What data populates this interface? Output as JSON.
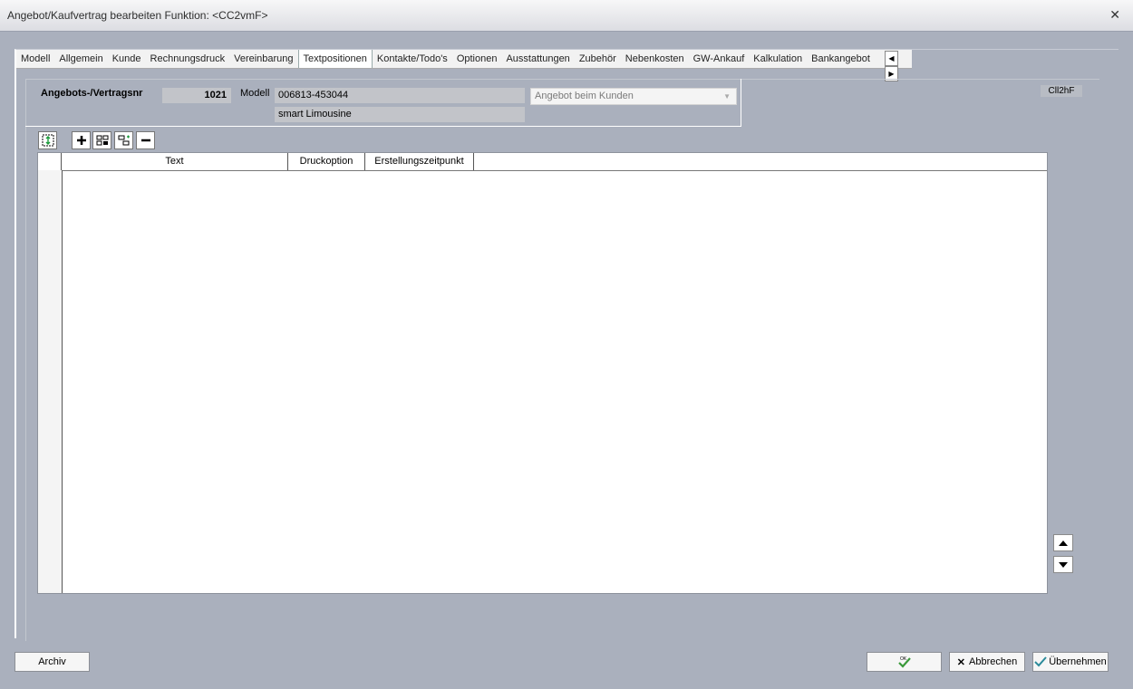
{
  "window": {
    "title": "Angebot/Kaufvertrag bearbeiten   Funktion: <CC2vmF>"
  },
  "tabs": [
    {
      "label": "Modell"
    },
    {
      "label": "Allgemein"
    },
    {
      "label": "Kunde"
    },
    {
      "label": "Rechnungsdruck"
    },
    {
      "label": "Vereinbarung"
    },
    {
      "label": "Textpositionen"
    },
    {
      "label": "Kontakte/Todo's"
    },
    {
      "label": "Optionen"
    },
    {
      "label": "Ausstattungen"
    },
    {
      "label": "Zubehör"
    },
    {
      "label": "Nebenkosten"
    },
    {
      "label": "GW-Ankauf"
    },
    {
      "label": "Kalkulation"
    },
    {
      "label": "Bankangebot"
    }
  ],
  "header": {
    "vertragsnr_label": "Angebots-/Vertragsnr",
    "vertragsnr_value": "1021",
    "modell_label": "Modell",
    "modell_code": "006813-453044",
    "modell_name": "smart Limousine",
    "status_value": "Angebot beim Kunden",
    "code": "Cll2hF"
  },
  "grid": {
    "columns": [
      "",
      "Text",
      "Druckoption",
      "Erstellungszeitpunkt"
    ],
    "rows": []
  },
  "buttons": {
    "archiv": "Archiv",
    "ok": "",
    "abbrechen": "Abbrechen",
    "uebernehmen": "Übernehmen"
  },
  "colors": {
    "background": "#aab0bd",
    "field": "#c2c4c9",
    "ok_check": "#3a9a3a"
  }
}
